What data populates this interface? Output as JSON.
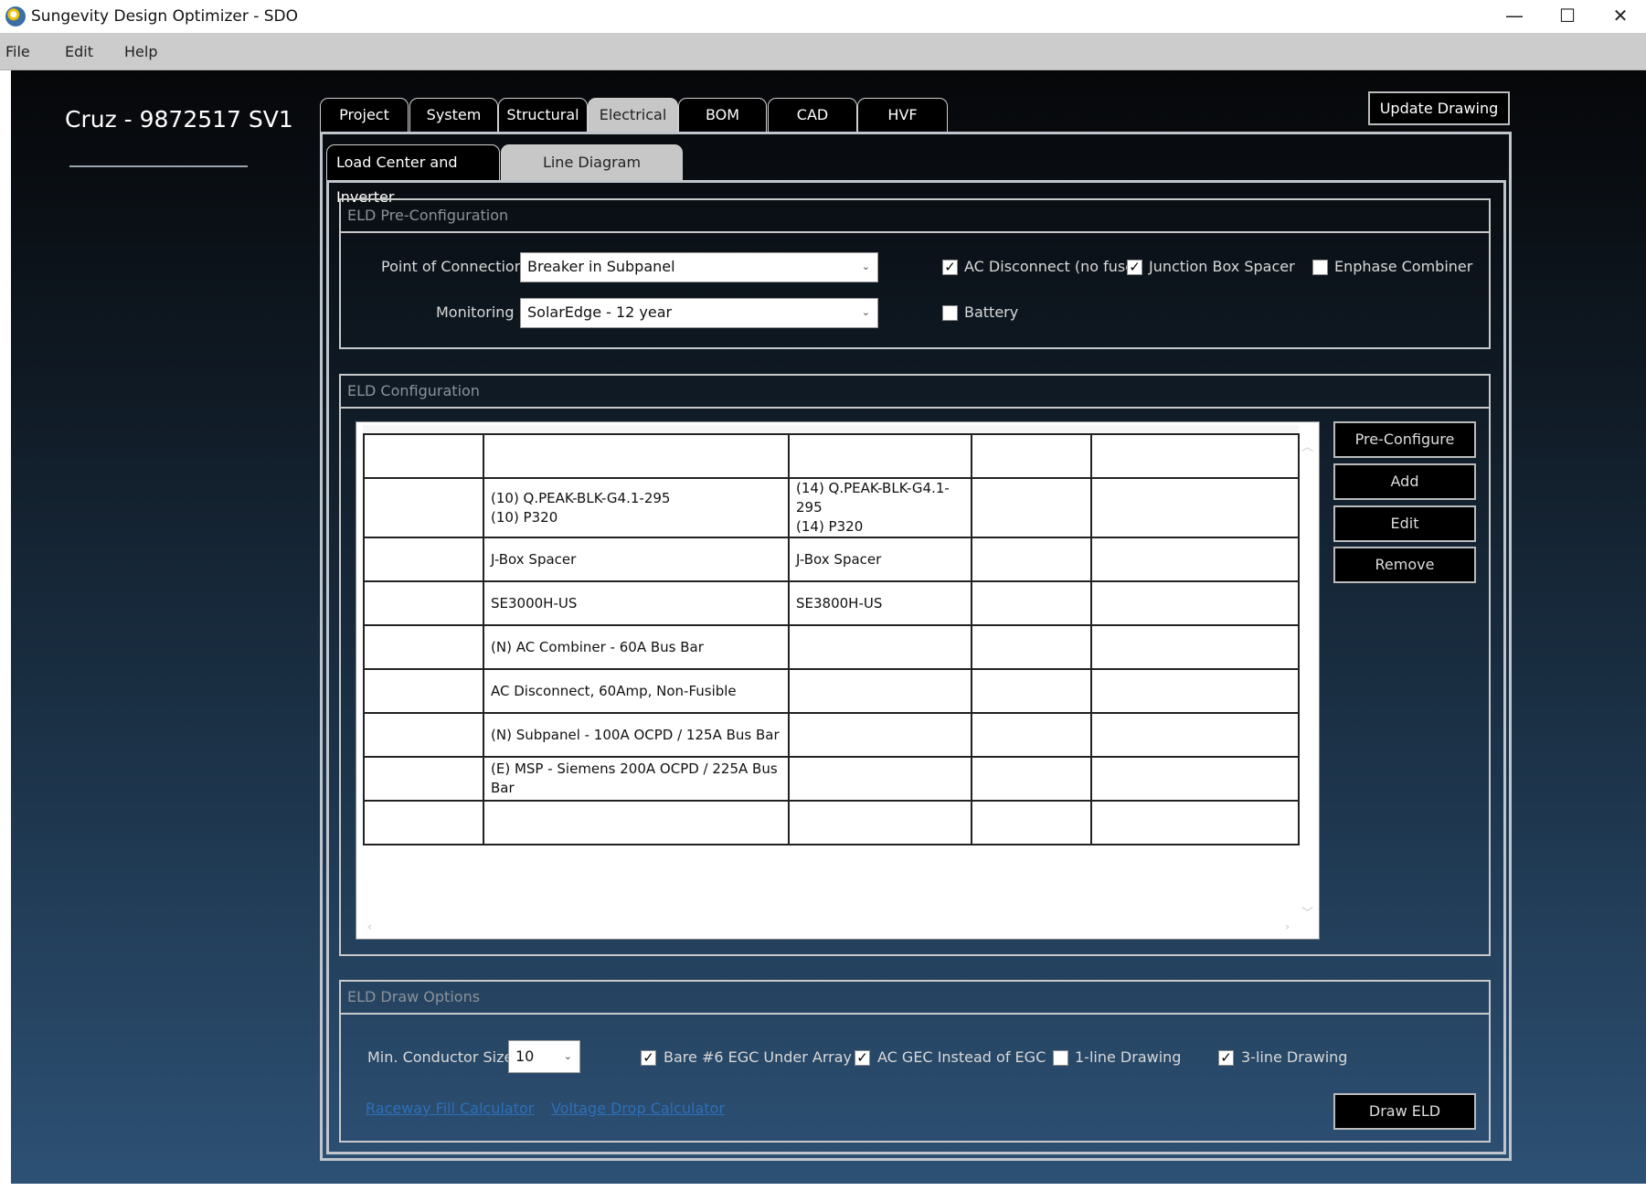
{
  "window": {
    "title": "Sungevity Design Optimizer - SDO",
    "minimize": "—",
    "maximize": "☐",
    "close": "✕"
  },
  "menu": [
    "File",
    "Edit",
    "Help"
  ],
  "project": {
    "title": "Cruz - 9872517 SV1"
  },
  "tabs": [
    "Project",
    "System",
    "Structural",
    "Electrical",
    "BOM",
    "CAD",
    "HVF"
  ],
  "active_tab": "Electrical",
  "update_drawing": "Update Drawing",
  "subtabs": [
    "Load Center and Inverter",
    "Line Diagram"
  ],
  "pre_config": {
    "header": "ELD Pre-Configuration",
    "poc_label": "Point of Connection",
    "poc_value": "Breaker in Subpanel",
    "monitoring_label": "Monitoring",
    "monitoring_value": "SolarEdge - 12 year",
    "ac_disconnect": {
      "label": "AC Disconnect (no fuse)",
      "checked": true
    },
    "junction_box_spacer": {
      "label": "Junction Box Spacer",
      "checked": true
    },
    "enphase_combiner": {
      "label": "Enphase Combiner",
      "checked": false
    },
    "battery": {
      "label": "Battery",
      "checked": false
    }
  },
  "config": {
    "header": "ELD Configuration",
    "rows": [
      [
        "",
        "",
        "",
        "",
        ""
      ],
      [
        "",
        "(10) Q.PEAK-BLK-G4.1-295\n(10) P320",
        "(14) Q.PEAK-BLK-G4.1-295\n(14) P320",
        "",
        ""
      ],
      [
        "",
        "J-Box Spacer",
        "J-Box Spacer",
        "",
        ""
      ],
      [
        "",
        "SE3000H-US",
        "SE3800H-US",
        "",
        ""
      ],
      [
        "",
        "(N) AC Combiner - 60A Bus Bar",
        "",
        "",
        ""
      ],
      [
        "",
        "AC Disconnect, 60Amp, Non-Fusible",
        "",
        "",
        ""
      ],
      [
        "",
        "(N) Subpanel - 100A OCPD / 125A Bus Bar",
        "",
        "",
        ""
      ],
      [
        "",
        "(E) MSP - Siemens 200A OCPD / 225A Bus Bar",
        "",
        "",
        ""
      ],
      [
        "",
        "",
        "",
        "",
        ""
      ]
    ],
    "buttons": [
      "Pre-Configure",
      "Add",
      "Edit",
      "Remove"
    ]
  },
  "draw_options": {
    "header": "ELD Draw Options",
    "min_conductor_label": "Min. Conductor Size",
    "min_conductor_value": "10",
    "bare_egc": {
      "label": "Bare #6 EGC Under Array",
      "checked": true
    },
    "ac_gec": {
      "label": "AC GEC Instead of EGC",
      "checked": true
    },
    "one_line": {
      "label": "1-line Drawing",
      "checked": false
    },
    "three_line": {
      "label": "3-line Drawing",
      "checked": true
    },
    "raceway_link": "Raceway Fill Calculator",
    "voltage_link": "Voltage Drop Calculator",
    "draw_button": "Draw ELD"
  }
}
